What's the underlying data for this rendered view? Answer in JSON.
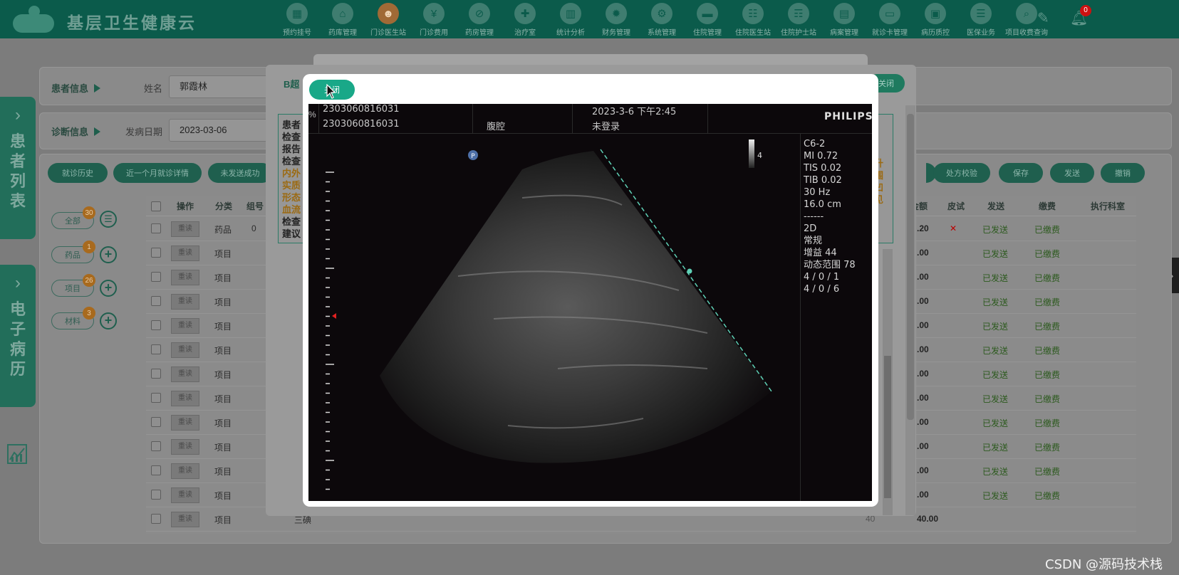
{
  "app": {
    "title": "基层卫生健康云",
    "notification_count": "0"
  },
  "nav": [
    {
      "label": "预约挂号",
      "icon": "calendar-icon",
      "glyph": "▦"
    },
    {
      "label": "药库管理",
      "icon": "home-icon",
      "glyph": "⌂"
    },
    {
      "label": "门诊医生站",
      "icon": "doctor-icon",
      "glyph": "☻"
    },
    {
      "label": "门诊费用",
      "icon": "yen-icon",
      "glyph": "¥"
    },
    {
      "label": "药房管理",
      "icon": "pill-icon",
      "glyph": "⊘"
    },
    {
      "label": "治疗室",
      "icon": "treatment-icon",
      "glyph": "✚"
    },
    {
      "label": "统计分析",
      "icon": "bar-chart-icon",
      "glyph": "▥"
    },
    {
      "label": "财务管理",
      "icon": "finance-gear-icon",
      "glyph": "✹"
    },
    {
      "label": "系统管理",
      "icon": "settings-icon",
      "glyph": "⚙"
    },
    {
      "label": "住院管理",
      "icon": "bed-icon",
      "glyph": "▬"
    },
    {
      "label": "住院医生站",
      "icon": "doctor-card-icon",
      "glyph": "☷"
    },
    {
      "label": "住院护士站",
      "icon": "nurse-card-icon",
      "glyph": "☶"
    },
    {
      "label": "病案管理",
      "icon": "record-icon",
      "glyph": "▤"
    },
    {
      "label": "就诊卡管理",
      "icon": "card-icon",
      "glyph": "▭"
    },
    {
      "label": "病历质控",
      "icon": "clipboard-icon",
      "glyph": "▣"
    },
    {
      "label": "医保业务",
      "icon": "insurance-icon",
      "glyph": "☰"
    },
    {
      "label": "项目收费查询",
      "icon": "search-doc-icon",
      "glyph": "⌕"
    }
  ],
  "side_tabs": {
    "patient_list": "患者列表",
    "emr": "电子病历"
  },
  "patient_panel": {
    "label": "患者信息",
    "name_label": "姓名",
    "name_value": "郭霞林"
  },
  "diagnosis_panel": {
    "label": "诊断信息",
    "onset_label": "发病日期",
    "onset_value": "2023-03-06"
  },
  "action_buttons": {
    "history": "就诊历史",
    "last_month": "近一个月就诊详情",
    "unsent": "未发送成功",
    "rx_check": "处方校验",
    "save": "保存",
    "send": "发送",
    "revoke": "撤销"
  },
  "filters": [
    {
      "label": "全部",
      "count": "30"
    },
    {
      "label": "药品",
      "count": "1"
    },
    {
      "label": "项目",
      "count": "26"
    },
    {
      "label": "材料",
      "count": "3"
    }
  ],
  "table": {
    "headers": {
      "action": "操作",
      "category": "分类",
      "group": "组号",
      "amount": "金额",
      "skin_test": "皮试",
      "send": "发送",
      "pay": "缴费",
      "dept": "执行科室"
    },
    "button_label": "重读",
    "rows": [
      {
        "category": "药品",
        "group": "0",
        "amount": ".20",
        "skin": "✕",
        "send": "已发送",
        "pay": "已缴费"
      },
      {
        "category": "项目",
        "group": "",
        "amount": ".00",
        "skin": "",
        "send": "已发送",
        "pay": "已缴费"
      },
      {
        "category": "项目",
        "group": "",
        "amount": ".00",
        "skin": "",
        "send": "已发送",
        "pay": "已缴费"
      },
      {
        "category": "项目",
        "group": "",
        "amount": ".00",
        "skin": "",
        "send": "已发送",
        "pay": "已缴费"
      },
      {
        "category": "项目",
        "group": "",
        "amount": ".00",
        "skin": "",
        "send": "已发送",
        "pay": "已缴费"
      },
      {
        "category": "项目",
        "group": "",
        "amount": ".00",
        "skin": "",
        "send": "已发送",
        "pay": "已缴费"
      },
      {
        "category": "项目",
        "group": "",
        "amount": ".00",
        "skin": "",
        "send": "已发送",
        "pay": "已缴费"
      },
      {
        "category": "项目",
        "group": "",
        "amount": ".00",
        "skin": "",
        "send": "已发送",
        "pay": "已缴费"
      },
      {
        "category": "项目",
        "group": "",
        "amount": ".00",
        "skin": "",
        "send": "已发送",
        "pay": "已缴费"
      },
      {
        "category": "项目",
        "group": "",
        "amount": ".00",
        "skin": "",
        "send": "已发送",
        "pay": "已缴费"
      },
      {
        "category": "项目",
        "group": "",
        "amount": ".00",
        "skin": "",
        "send": "已发送",
        "pay": "已缴费"
      },
      {
        "category": "项目",
        "group": "",
        "amount": ".00",
        "skin": "",
        "send": "已发送",
        "pay": "已缴费"
      },
      {
        "category": "项目",
        "group": "",
        "amount": "40.00",
        "skin": "",
        "send": "",
        "pay": ""
      }
    ],
    "last_row_name": "三碘",
    "last_row_amount2": "40"
  },
  "bchao_dialog": {
    "title": "B超",
    "close_label": "关闭",
    "form_labels": [
      "患者",
      "检查",
      "报告",
      "检查",
      "内外",
      "实质",
      "形态",
      "血流",
      "检查",
      "建议"
    ],
    "right_hint": [
      "升",
      "围",
      "凹",
      "见"
    ]
  },
  "image_modal": {
    "close_label": "关闭",
    "ultrasound": {
      "id_top": "2303060816031",
      "id_bottom": "2303060816031",
      "datetime": "2023-3-6   下午2:45",
      "region": "腹腔",
      "login": "未登录",
      "brand": "PHILIPS",
      "percent_symbol": "%",
      "scale_value": "4",
      "probe_marker": "P",
      "params": [
        "C6-2",
        "MI 0.72",
        "TIS 0.02",
        "TIB 0.02",
        "30 Hz",
        "16.0 cm",
        "------",
        "2D",
        "常规",
        "增益 44",
        "动态范围 78",
        "4 / 0 / 1",
        "4 / 0 / 6"
      ]
    }
  },
  "watermark": "CSDN @源码技术栈"
}
